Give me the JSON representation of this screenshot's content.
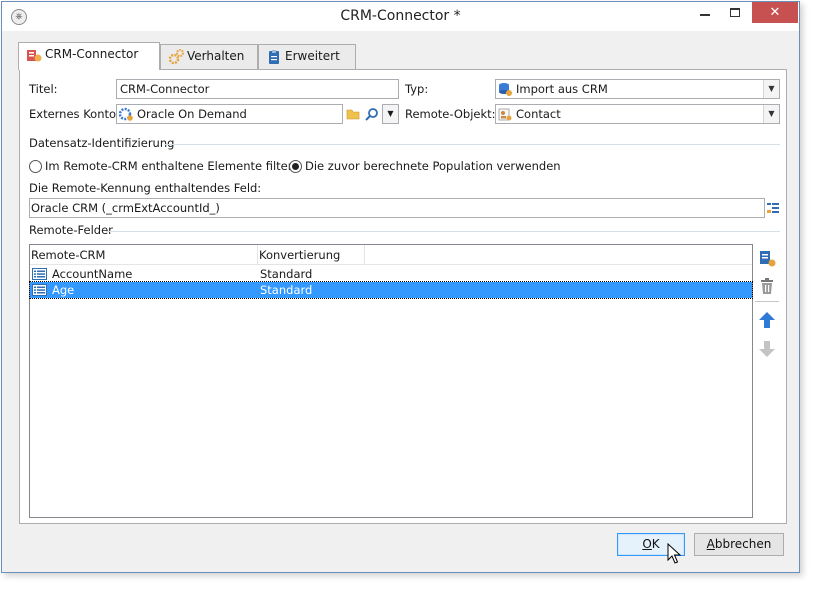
{
  "window": {
    "title": "CRM-Connector *",
    "close_glyph": "✕"
  },
  "tabs": [
    {
      "label": "CRM-Connector",
      "icon": "crm-connector-icon"
    },
    {
      "label": "Verhalten",
      "icon": "gears-icon"
    },
    {
      "label": "Erweitert",
      "icon": "clipboard-icon"
    }
  ],
  "form": {
    "titel_label": "Titel:",
    "titel_value": "CRM-Connector",
    "typ_label": "Typ:",
    "typ_value": "Import aus CRM",
    "konto_label": "Externes Konto:",
    "konto_value": "Oracle On Demand",
    "remote_objekt_label": "Remote-Objekt:",
    "remote_objekt_value": "Contact"
  },
  "identification": {
    "section_title": "Datensatz-Identifizierung",
    "radio1_label": "Im Remote-CRM enthaltene Elemente filtern",
    "radio1_checked": false,
    "radio2_label": "Die zuvor berechnete Population verwenden",
    "radio2_checked": true,
    "field_label": "Die Remote-Kennung enthaltendes Feld:",
    "field_value": "Oracle CRM (_crmExtAccountId_)"
  },
  "remote_fields": {
    "section_title": "Remote-Felder",
    "columns": [
      "Remote-CRM",
      "Konvertierung"
    ],
    "rows": [
      {
        "name": "AccountName",
        "conversion": "Standard",
        "selected": false
      },
      {
        "name": "Age",
        "conversion": "Standard",
        "selected": true
      }
    ]
  },
  "buttons": {
    "ok": "OK",
    "cancel": "Abbrechen"
  },
  "colors": {
    "selection": "#3399ff",
    "close_button": "#c75050",
    "window_border": "#6b8fba"
  }
}
